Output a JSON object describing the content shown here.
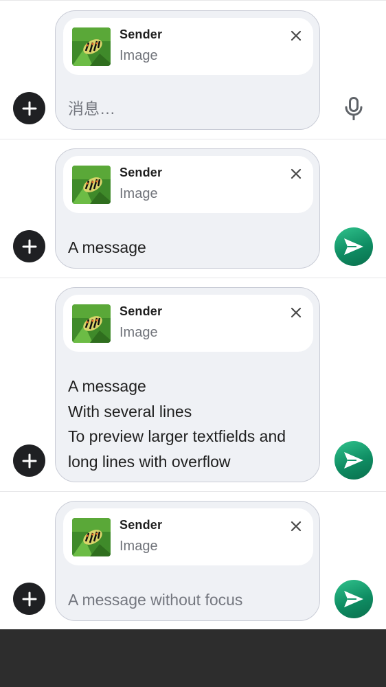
{
  "composers": [
    {
      "reply": {
        "sender": "Sender",
        "subtitle": "Image"
      },
      "text": "消息…",
      "is_placeholder": true,
      "action": "mic-icon"
    },
    {
      "reply": {
        "sender": "Sender",
        "subtitle": "Image"
      },
      "text": "A message",
      "is_placeholder": false,
      "action": "send-icon"
    },
    {
      "reply": {
        "sender": "Sender",
        "subtitle": "Image"
      },
      "text": "A message\nWith several lines\nTo preview larger textfields and\nlong lines with overflow",
      "is_placeholder": false,
      "action": "send-icon"
    },
    {
      "reply": {
        "sender": "Sender",
        "subtitle": "Image"
      },
      "text": "A message without focus",
      "is_placeholder": true,
      "action": "send-icon"
    }
  ],
  "colors": {
    "bubble_bg": "#eff1f5",
    "send_green": "#12956a",
    "add_button": "#1f2023"
  }
}
